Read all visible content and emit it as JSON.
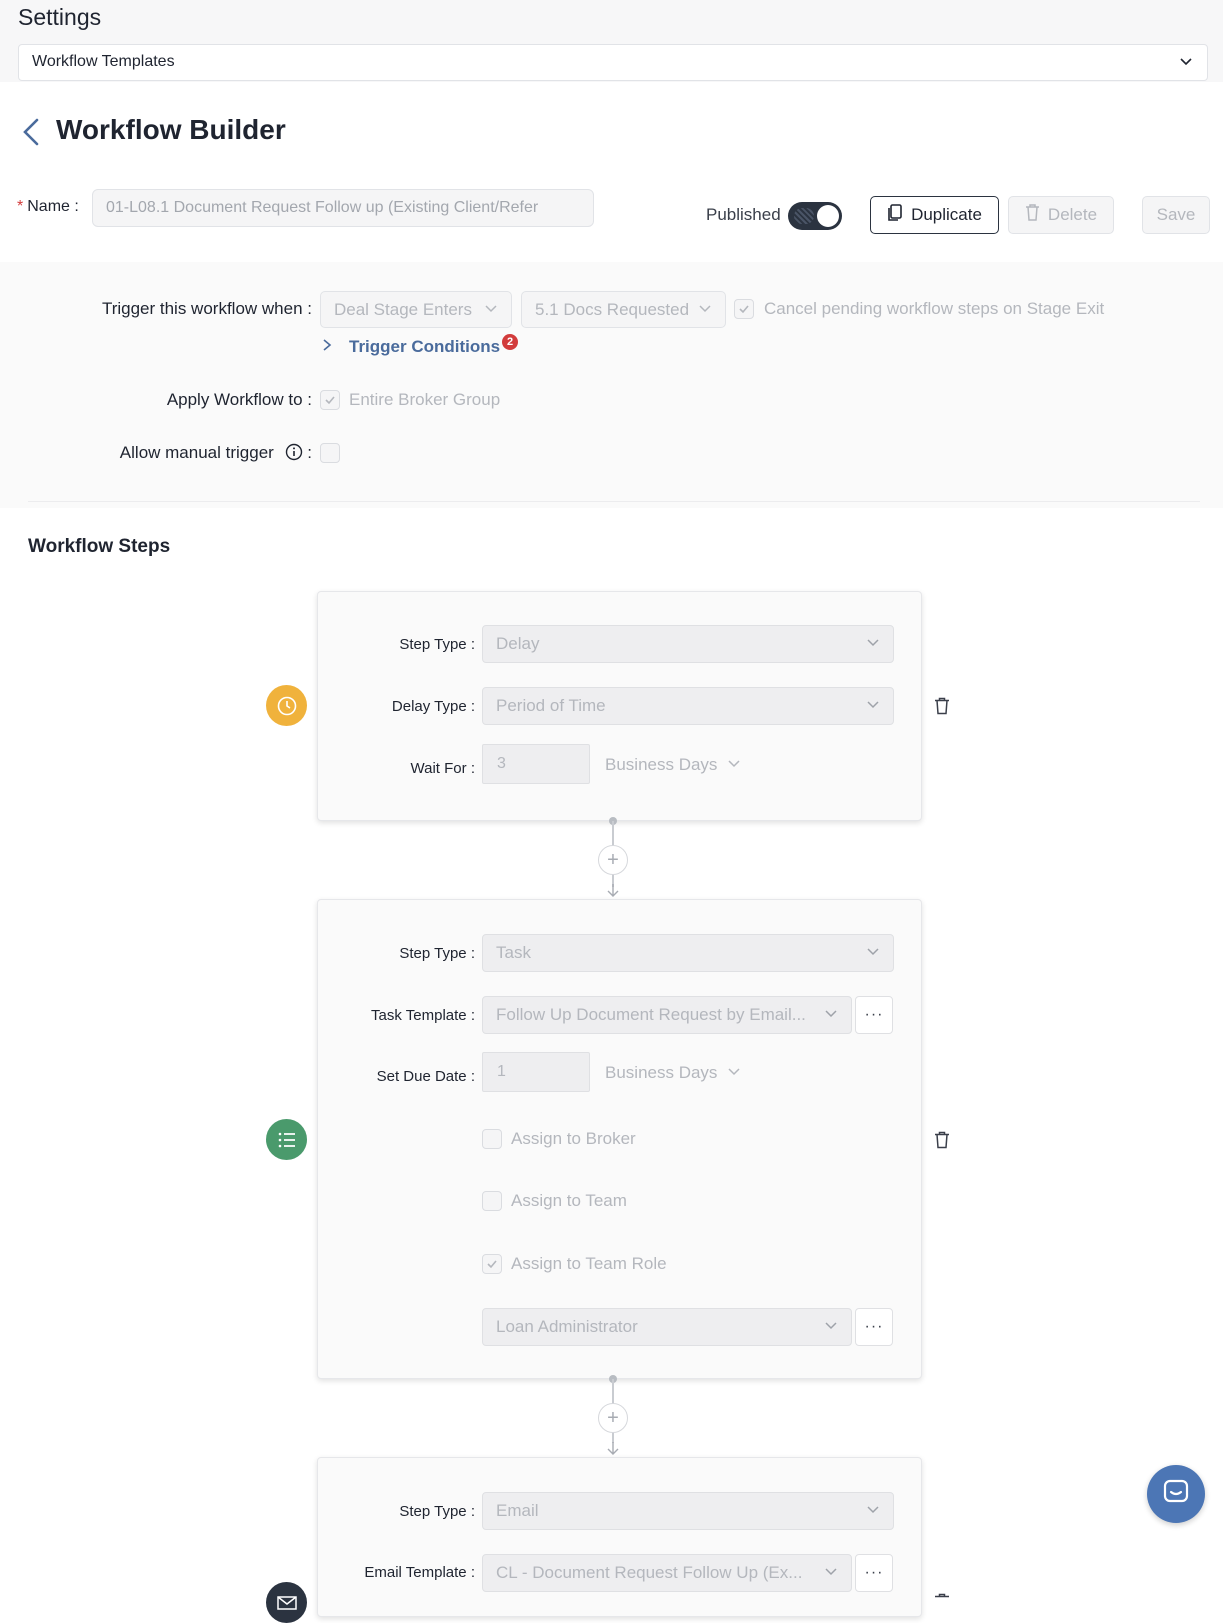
{
  "header": {
    "title": "Settings",
    "section_select": "Workflow Templates"
  },
  "builder": {
    "title": "Workflow Builder",
    "name_label": "Name",
    "name_value": "01-L08.1 Document Request Follow up (Existing Client/Refer",
    "published_label": "Published",
    "published": true,
    "duplicate_label": "Duplicate",
    "delete_label": "Delete",
    "save_label": "Save"
  },
  "config": {
    "trigger_label": "Trigger this workflow when",
    "trigger_event": "Deal Stage Enters",
    "trigger_stage": "5.1 Docs Requested",
    "cancel_pending_label": "Cancel pending workflow steps on Stage Exit",
    "cancel_pending_checked": true,
    "trigger_conditions_label": "Trigger Conditions",
    "trigger_conditions_count": "2",
    "apply_label": "Apply Workflow to",
    "apply_value": "Entire Broker Group",
    "apply_checked": true,
    "manual_label": "Allow manual trigger",
    "manual_checked": false
  },
  "steps_title": "Workflow Steps",
  "steps": [
    {
      "type_label": "Step Type",
      "type_value": "Delay",
      "delay_type_label": "Delay Type",
      "delay_type_value": "Period of Time",
      "wait_label": "Wait For",
      "wait_value": "3",
      "wait_unit": "Business Days",
      "icon": "clock-icon",
      "icon_color": "#f0b23c"
    },
    {
      "type_label": "Step Type",
      "type_value": "Task",
      "template_label": "Task Template",
      "template_value": "Follow Up Document Request by Email...",
      "due_label": "Set Due Date",
      "due_value": "1",
      "due_unit": "Business Days",
      "assign_broker": "Assign to Broker",
      "assign_team": "Assign to Team",
      "assign_role": "Assign to Team Role",
      "role_value": "Loan Administrator",
      "icon": "task-list-icon",
      "icon_color": "#4a9a6c"
    },
    {
      "type_label": "Step Type",
      "type_value": "Email",
      "template_label": "Email Template",
      "template_value": "CL - Document Request Follow Up (Ex...",
      "icon": "email-icon",
      "icon_color": "#2b3340"
    }
  ],
  "colors": {
    "accent": "#4a6b9c",
    "badge": "#d23b3b",
    "chat": "#4c76b5"
  }
}
